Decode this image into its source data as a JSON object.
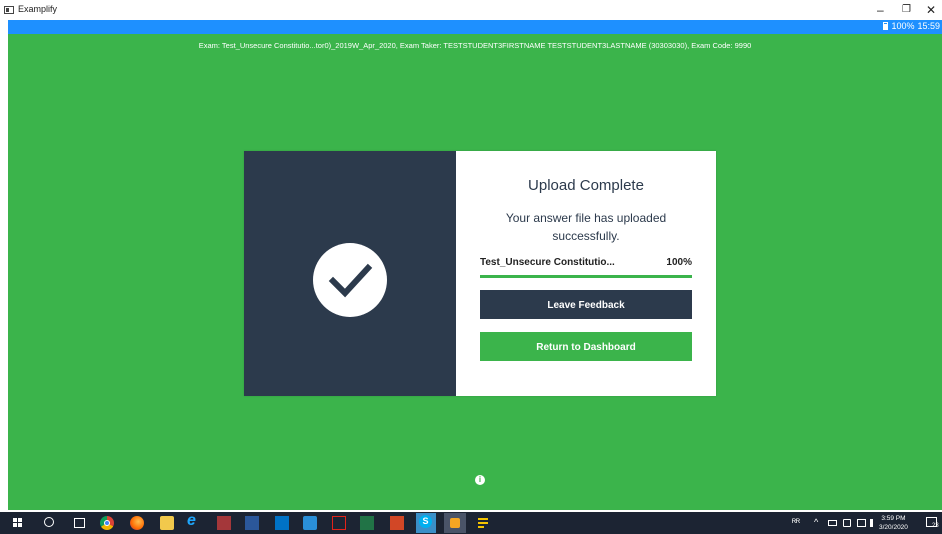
{
  "window": {
    "title": "Examplify",
    "minimize_glyph": "–",
    "maximize_glyph": "❐",
    "close_glyph": "✕"
  },
  "status": {
    "battery": "100%",
    "time": "15:59"
  },
  "exam_info": "Exam: Test_Unsecure Constitutio...tor0)_2019W_Apr_2020, Exam Taker: TESTSTUDENT3FIRSTNAME TESTSTUDENT3LASTNAME (30303030), Exam Code: 9990",
  "upload": {
    "title": "Upload Complete",
    "message": "Your answer file has uploaded successfully.",
    "file_name": "Test_Unsecure Constitutio...",
    "progress_label": "100%",
    "progress": 1.0,
    "leave_feedback_label": "Leave Feedback",
    "return_dashboard_label": "Return to Dashboard"
  },
  "info_glyph": "i",
  "taskbar": {
    "ie_glyph": "e",
    "tray_people": "ᴿᴿ",
    "tray_chevron": "^",
    "tray_time": "3:59 PM",
    "tray_date": "3/20/2020",
    "notif_badge": "23"
  },
  "colors": {
    "green": "#3bb44b",
    "navy": "#2c3a4c",
    "blue_bar": "#1e90ff"
  }
}
